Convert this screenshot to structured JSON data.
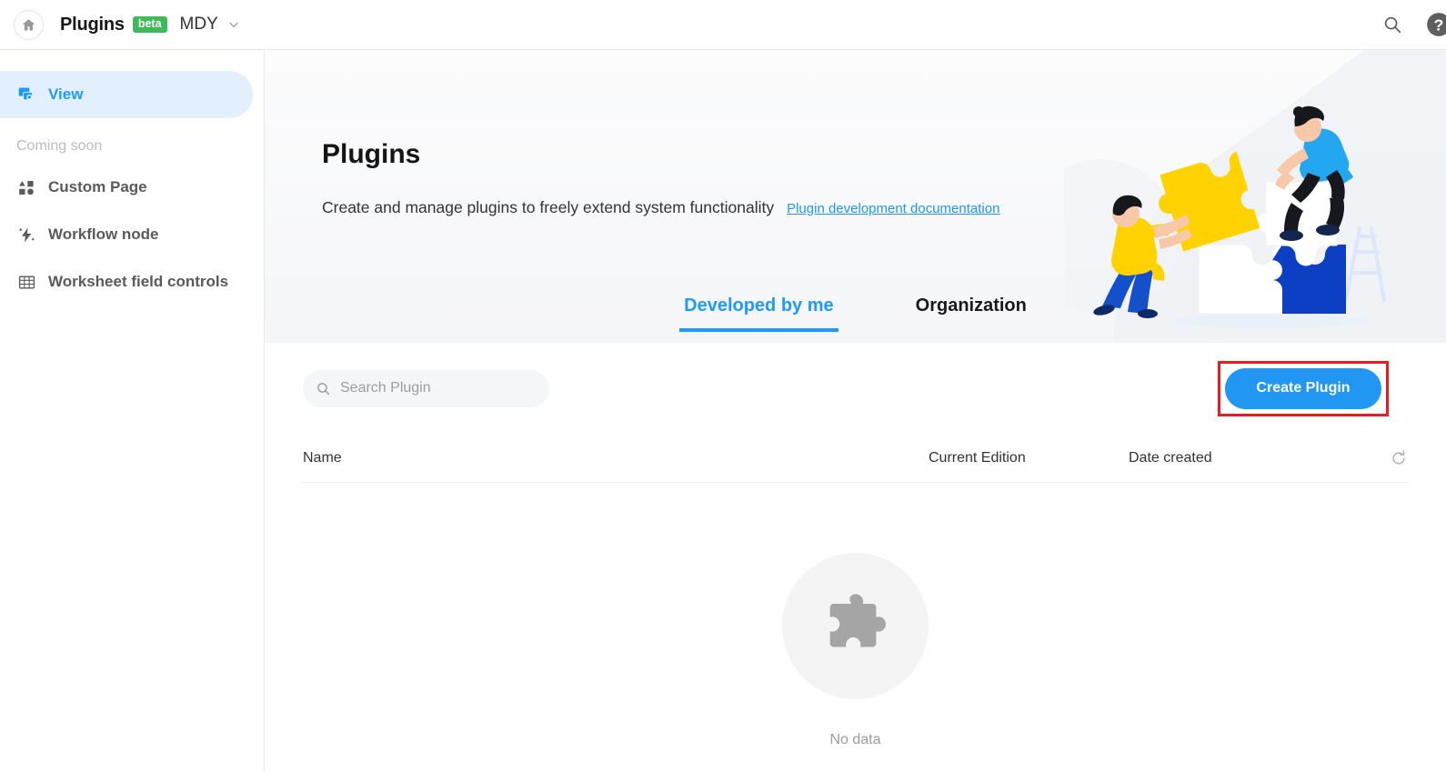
{
  "header": {
    "home_icon": "home-icon",
    "app_title": "Plugins",
    "beta_label": "beta",
    "org_name": "MDY",
    "caret_icon": "chevron-down-icon",
    "search_icon": "search-icon",
    "help_icon": "help-circle-icon"
  },
  "sidebar": {
    "items": [
      {
        "label": "View",
        "icon": "view-window-icon",
        "active": true
      }
    ],
    "coming_soon_label": "Coming soon",
    "coming_soon_items": [
      {
        "label": "Custom Page",
        "icon": "shapes-icon"
      },
      {
        "label": "Workflow node",
        "icon": "lightning-icon"
      },
      {
        "label": "Worksheet field controls",
        "icon": "grid-table-icon"
      }
    ]
  },
  "hero": {
    "title": "Plugins",
    "subtitle": "Create and manage plugins to freely extend system functionality",
    "doc_link": "Plugin development documentation",
    "illustration": "people-assembling-puzzle-illustration"
  },
  "tabs": [
    {
      "label": "Developed by me",
      "active": true
    },
    {
      "label": "Organization",
      "active": false
    }
  ],
  "toolbar": {
    "search_placeholder": "Search Plugin",
    "search_value": "",
    "search_icon": "search-icon",
    "create_label": "Create Plugin"
  },
  "table": {
    "columns": [
      "Name",
      "Current Edition",
      "Date created"
    ],
    "refresh_icon": "refresh-icon",
    "rows": []
  },
  "empty_state": {
    "icon": "puzzle-piece-icon",
    "text": "No data"
  },
  "colors": {
    "accent": "#2196f3",
    "accent_light": "#e2f0fd",
    "beta_green": "#3fb95a",
    "annotation_red": "#ea1c22",
    "puzzle_yellow": "#ffd200",
    "puzzle_blue": "#0c3fc4",
    "shirt_blue": "#22a7f0"
  }
}
